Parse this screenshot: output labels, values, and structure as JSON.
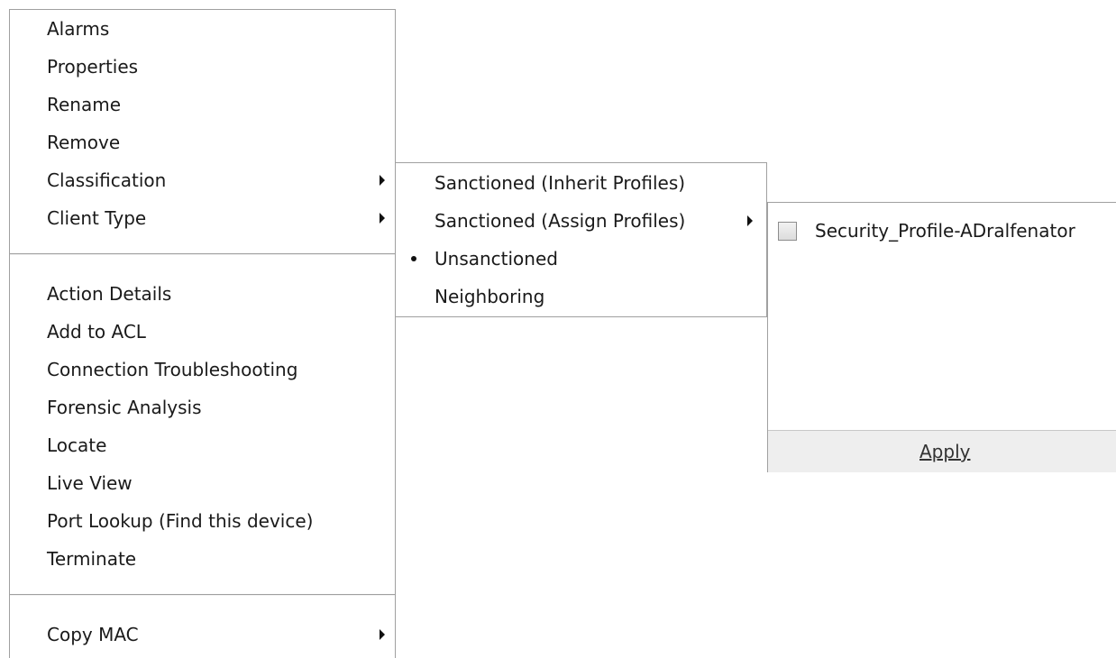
{
  "main_menu": {
    "items": [
      {
        "label": "Alarms"
      },
      {
        "label": "Properties"
      },
      {
        "label": "Rename"
      },
      {
        "label": "Remove"
      },
      {
        "label": "Classification",
        "has_submenu": true
      },
      {
        "label": "Client Type",
        "has_submenu": true
      },
      {
        "label": "Action Details"
      },
      {
        "label": "Add to ACL"
      },
      {
        "label": "Connection Troubleshooting"
      },
      {
        "label": "Forensic Analysis"
      },
      {
        "label": "Locate"
      },
      {
        "label": "Live View"
      },
      {
        "label": "Port Lookup (Find this device)"
      },
      {
        "label": "Terminate"
      },
      {
        "label": "Copy MAC",
        "has_submenu": true
      }
    ]
  },
  "classification_menu": {
    "items": [
      {
        "label": "Sanctioned (Inherit Profiles)",
        "selected": false
      },
      {
        "label": "Sanctioned (Assign Profiles)",
        "selected": false,
        "has_submenu": true
      },
      {
        "label": "Unsanctioned",
        "selected": true
      },
      {
        "label": "Neighboring",
        "selected": false
      }
    ]
  },
  "profile_panel": {
    "profiles": [
      {
        "label": "Security_Profile-ADralfenator",
        "checked": false
      }
    ],
    "apply_label": "Apply"
  }
}
